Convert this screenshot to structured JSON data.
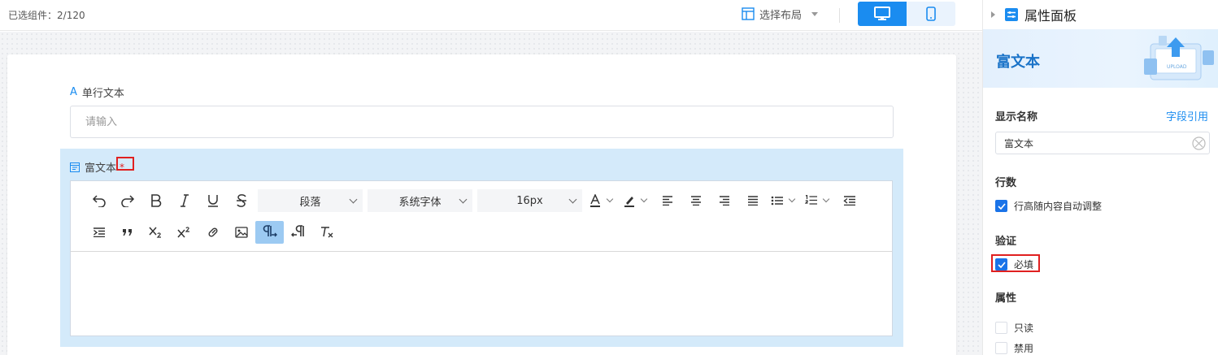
{
  "topbar": {
    "selected_label": "已选组件：",
    "selected_count": "2/120",
    "layout_select_label": "选择布局",
    "devices": [
      "desktop-icon",
      "mobile-icon"
    ],
    "active_device": "desktop"
  },
  "form": {
    "single_text": {
      "label": "单行文本",
      "placeholder": "请输入"
    },
    "rich_text": {
      "label": "富文本",
      "required_mark": "*",
      "toolbar": {
        "row1": [
          "undo-icon",
          "redo-icon",
          "bold-icon",
          "italic-icon",
          "underline-icon",
          "strikethrough-icon"
        ],
        "paragraph_select": "段落",
        "font_select": "系统字体",
        "size_select": "16px",
        "row1_tail": [
          "font-color-icon",
          "highlight-icon",
          "align-left-icon",
          "align-center-icon",
          "align-right-icon",
          "justify-icon",
          "bullet-list-icon",
          "ordered-list-icon",
          "outdent-icon"
        ],
        "row2": [
          "indent-icon",
          "blockquote-icon",
          "subscript-icon",
          "superscript-icon",
          "link-icon",
          "image-icon",
          "ltr-icon",
          "rtl-icon",
          "clear-format-icon"
        ],
        "active_tool": "ltr-icon"
      }
    }
  },
  "panel": {
    "title": "属性面板",
    "banner_title": "富文本",
    "banner_illustration_text": "UPLOAD",
    "display_name_label": "显示名称",
    "field_ref_link": "字段引用",
    "display_name_value": "富文本",
    "rows_label": "行数",
    "auto_height_label": "行高随内容自动调整",
    "auto_height_checked": true,
    "validation_label": "验证",
    "required_label": "必填",
    "required_checked": true,
    "attributes_label": "属性",
    "readonly_label": "只读",
    "readonly_checked": false,
    "disabled_label": "禁用",
    "disabled_checked": false
  },
  "colors": {
    "accent": "#1a8cf0",
    "selection_bg": "#d4eafa",
    "highlight_red": "#e02020"
  }
}
